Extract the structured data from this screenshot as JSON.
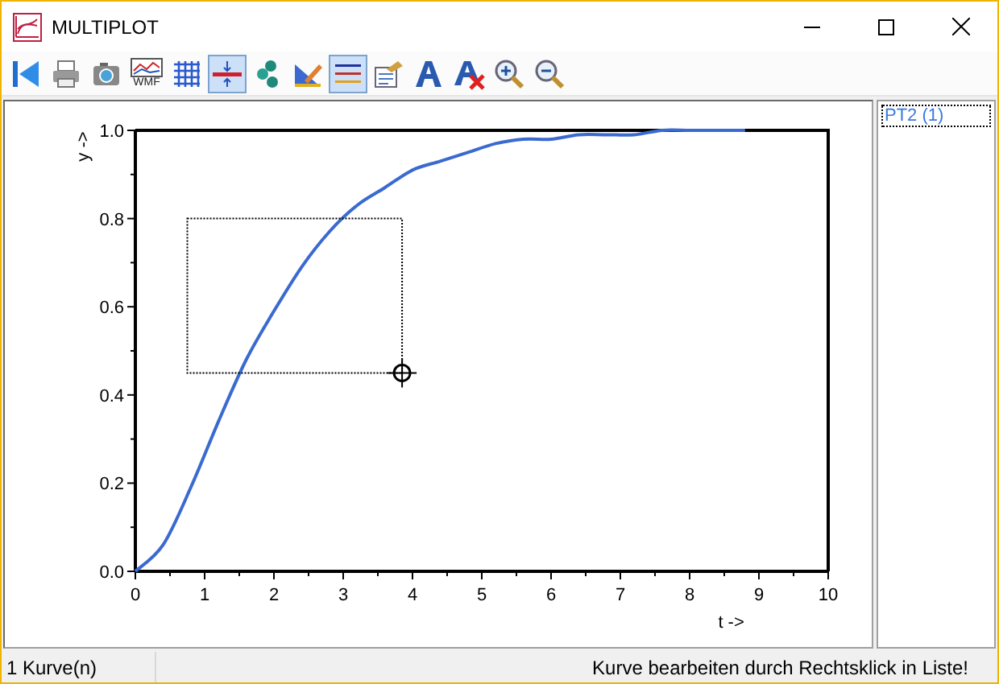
{
  "window": {
    "title": "MULTIPLOT"
  },
  "toolbar": [
    {
      "kind": "back",
      "selected": false
    },
    {
      "kind": "print",
      "selected": false
    },
    {
      "kind": "camera",
      "selected": false
    },
    {
      "kind": "wmf",
      "selected": false,
      "label": "WMF"
    },
    {
      "kind": "grid",
      "selected": false
    },
    {
      "kind": "cursor",
      "selected": true
    },
    {
      "kind": "points",
      "selected": false
    },
    {
      "kind": "ruler",
      "selected": false
    },
    {
      "kind": "lines",
      "selected": true
    },
    {
      "kind": "properties",
      "selected": false
    },
    {
      "kind": "font",
      "selected": false
    },
    {
      "kind": "fontdelete",
      "selected": false
    },
    {
      "kind": "zoomin",
      "selected": false
    },
    {
      "kind": "zoomout",
      "selected": false
    }
  ],
  "plot": {
    "chart_data": {
      "type": "line",
      "xlabel": "t ->",
      "ylabel": "y ->",
      "xlim": [
        0,
        10
      ],
      "ylim": [
        0,
        1
      ],
      "xticks": [
        0,
        1,
        2,
        3,
        4,
        5,
        6,
        7,
        8,
        9,
        10
      ],
      "yticks": [
        {
          "value": 0,
          "label": "0.0"
        },
        {
          "value": 0.2,
          "label": "0.2"
        },
        {
          "value": 0.4,
          "label": "0.4"
        },
        {
          "value": 0.6,
          "label": "0.6"
        },
        {
          "value": 0.8,
          "label": "0.8"
        },
        {
          "value": 1,
          "label": "1.0"
        }
      ],
      "x": [
        0,
        0.4,
        0.8,
        1.2,
        1.6,
        2.0,
        2.4,
        2.8,
        3.2,
        3.6,
        4.0,
        4.4,
        4.8,
        5.2,
        5.6,
        6.0,
        6.4,
        6.8,
        7.2,
        7.6,
        8.0,
        8.4,
        8.8
      ],
      "series": [
        {
          "color": "#3a6ad0",
          "values": [
            0,
            0.06,
            0.19,
            0.34,
            0.48,
            0.59,
            0.69,
            0.77,
            0.83,
            0.87,
            0.91,
            0.93,
            0.95,
            0.97,
            0.98,
            0.98,
            0.99,
            0.99,
            0.99,
            1.0,
            1.0,
            1.0,
            1.0
          ]
        }
      ]
    }
  },
  "curve_list": [
    {
      "label": "PT2 (1)",
      "selected": true
    }
  ],
  "status_bar": {
    "left": "1 Kurve(n)",
    "right": "Kurve bearbeiten durch Rechtsklick in Liste!"
  }
}
